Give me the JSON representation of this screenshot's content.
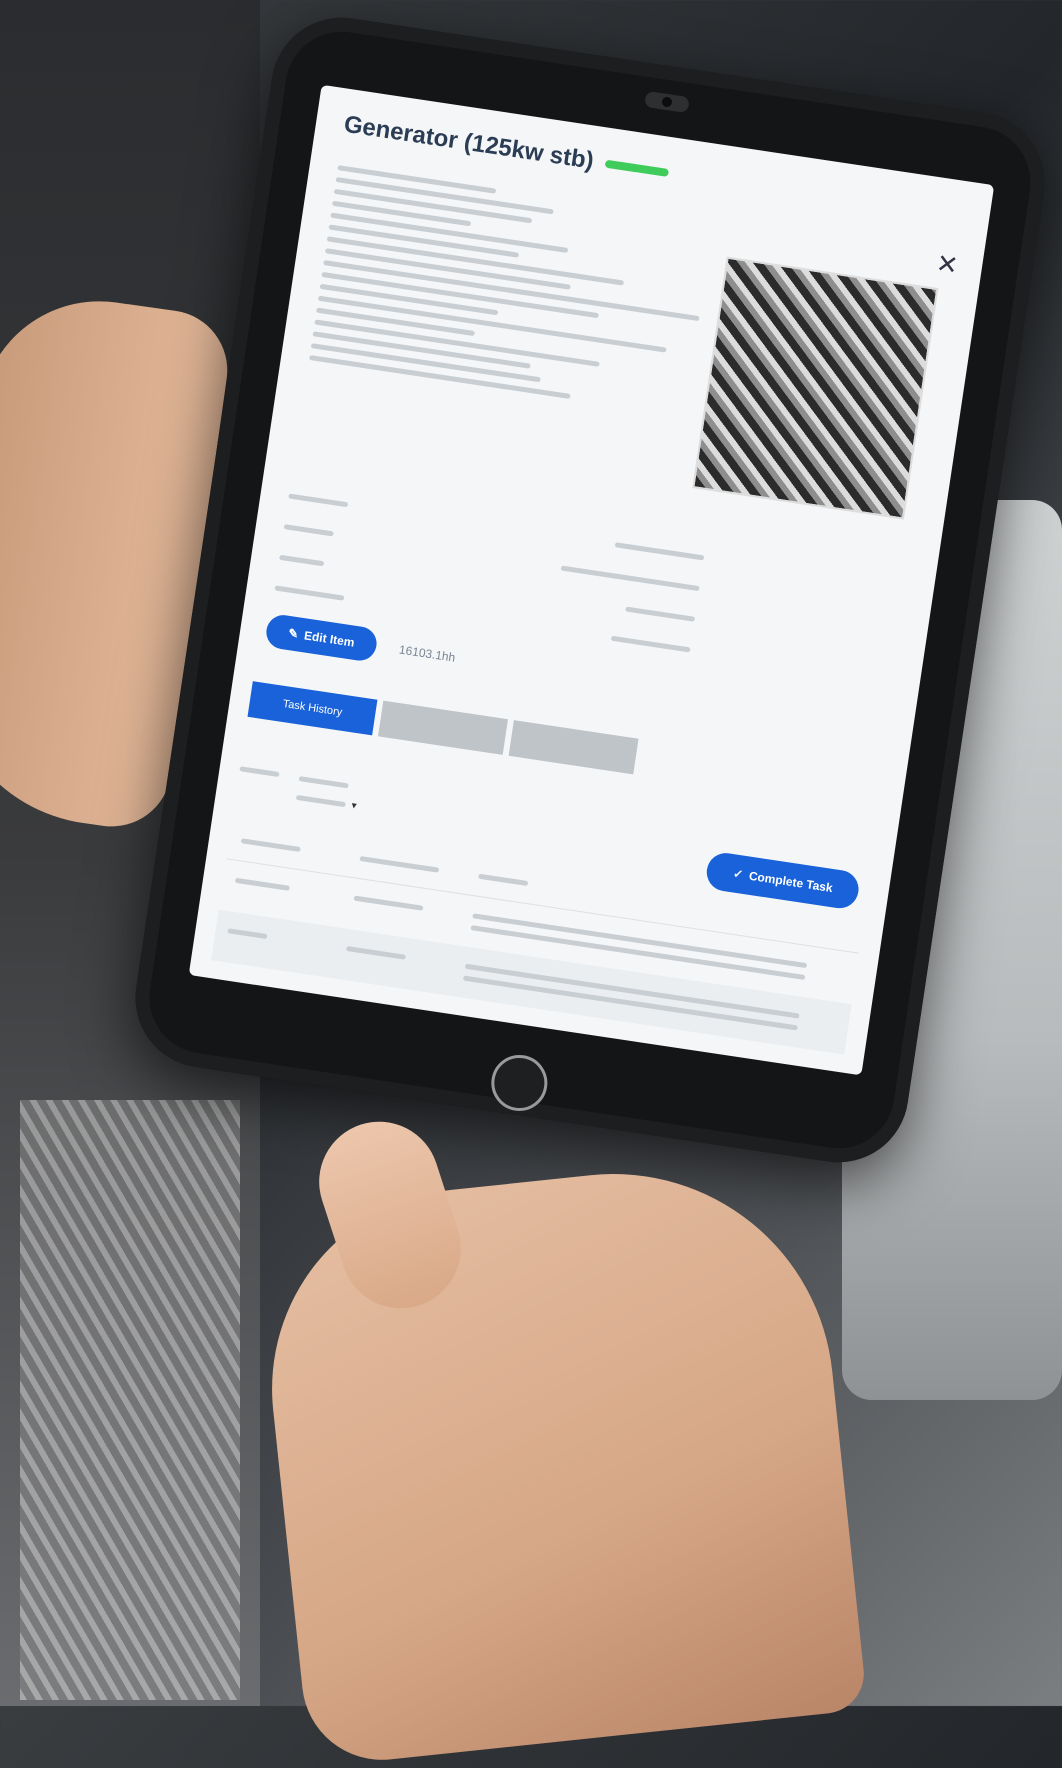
{
  "dialog": {
    "title": "Generator (125kw stb)",
    "status_badge": "",
    "close_glyph": "✕"
  },
  "actions": {
    "edit_label": "Edit Item",
    "edit_icon": "edit-icon",
    "complete_label": "Complete Task",
    "complete_icon": "check-icon",
    "hours_text": "16103.1hh"
  },
  "tabs": [
    {
      "label": "Task History",
      "active": true
    },
    {
      "label": "",
      "active": false
    },
    {
      "label": "",
      "active": false
    }
  ],
  "colors": {
    "accent": "#1a62d9",
    "badge": "#3fcc5a",
    "title": "#2b3c55"
  }
}
